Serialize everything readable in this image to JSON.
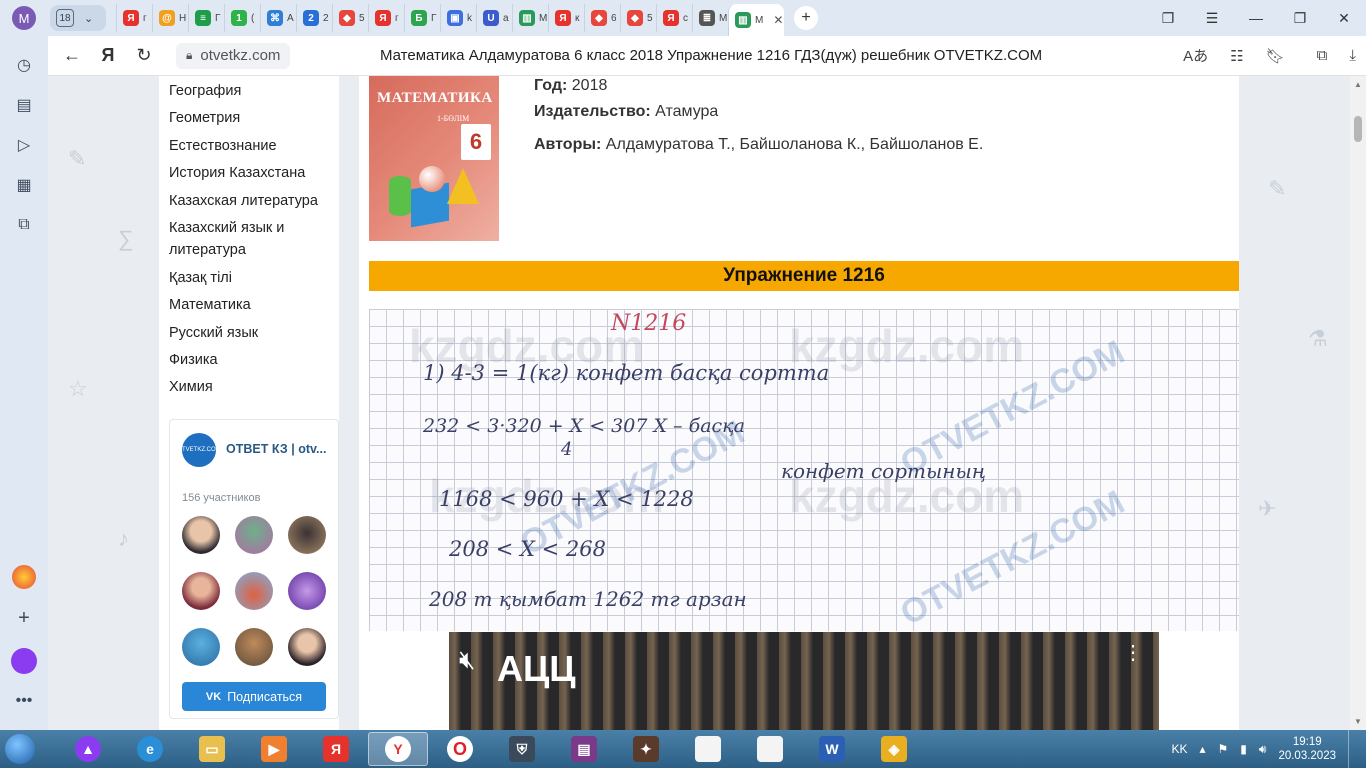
{
  "browser": {
    "profile_initial": "M",
    "tab_count": "18",
    "tabs": [
      {
        "letter": "Я",
        "color": "#e5322d",
        "text": "г"
      },
      {
        "letter": "@",
        "color": "#f0a020",
        "text": "Н"
      },
      {
        "letter": "≡",
        "color": "#1e9e4a",
        "text": "Г"
      },
      {
        "letter": "1",
        "color": "#2db34a",
        "text": "("
      },
      {
        "letter": "⌘",
        "color": "#2f7fd6",
        "text": "А"
      },
      {
        "letter": "2",
        "color": "#2a6fd6",
        "text": "2"
      },
      {
        "letter": "◆",
        "color": "#e8453c",
        "text": "5"
      },
      {
        "letter": "Я",
        "color": "#e5322d",
        "text": "г"
      },
      {
        "letter": "Б",
        "color": "#2da44e",
        "text": "Г"
      },
      {
        "letter": "▣",
        "color": "#3d6fe0",
        "text": "k"
      },
      {
        "letter": "U",
        "color": "#3a5ccc",
        "text": "а"
      },
      {
        "letter": "▥",
        "color": "#2a9a5a",
        "text": "М"
      },
      {
        "letter": "Я",
        "color": "#e5322d",
        "text": "к"
      },
      {
        "letter": "◆",
        "color": "#e8453c",
        "text": "6"
      },
      {
        "letter": "◆",
        "color": "#e8453c",
        "text": "5"
      },
      {
        "letter": "Я",
        "color": "#e5322d",
        "text": "с"
      },
      {
        "letter": "≣",
        "color": "#555555",
        "text": "М"
      }
    ],
    "active_tab": {
      "letter": "▥",
      "color": "#2a9a5a",
      "text": "М"
    },
    "url": "otvetkz.com",
    "page_title": "Математика Алдамуратова 6 класс 2018 Упражнение 1216 ГДЗ(дүж) решебник OTVETKZ.COM"
  },
  "sidebar_menu": {
    "subjects": [
      "География",
      "Геометрия",
      "Естествознание",
      "История Казахстана",
      "Казахская литература",
      "Казахский язык и",
      "литература",
      "Қазақ тілі",
      "Математика",
      "Русский язык",
      "Физика",
      "Химия"
    ]
  },
  "vk_widget": {
    "logo_text": "OTVETKZ.COM",
    "name": "ОТВЕТ КЗ | otv...",
    "members": "156 участников",
    "subscribe_label": "Подписаться",
    "subscribe_icon": "VK"
  },
  "book": {
    "cover_title": "МАТЕМАТИКА",
    "cover_part": "1-БӨЛІМ",
    "cover_grade": "6",
    "year_label": "Год:",
    "year_value": "2018",
    "publisher_label": "Издательство:",
    "publisher_value": "Атамура",
    "authors_label": "Авторы:",
    "authors_value": "Алдамуратова Т., Байшоланова К., Байшоланов Е."
  },
  "exercise": {
    "title": "Упражнение 1216"
  },
  "solution": {
    "lines": [
      "N1216",
      "1) 4-3 = 1(кг) конфет басқа сортта",
      "232 < 3·320 + X < 307    X – басқа",
      "4",
      "конфет сортының",
      "1168 < 960 + X < 1228",
      "208 < X < 268",
      "208 т қымбат   1262 тг   арзан"
    ],
    "watermarks": [
      "kzgdz.com",
      "OTVETKZ.COM"
    ]
  },
  "video": {
    "logo": "АЦЦ",
    "mute_icon": "muted-speaker-icon",
    "menu_icon": "vertical-dots-icon"
  },
  "taskbar": {
    "language": "KK",
    "time": "19:19",
    "date": "20.03.2023"
  }
}
